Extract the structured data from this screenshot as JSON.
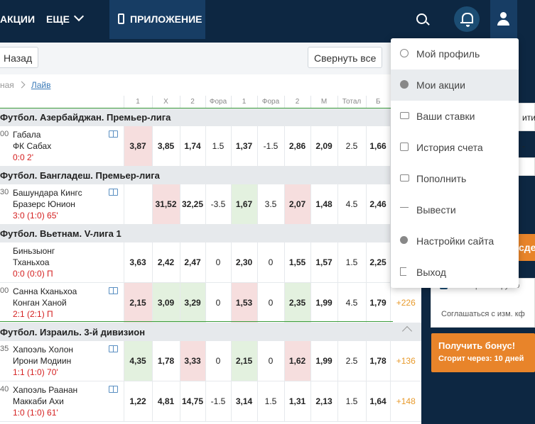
{
  "header": {
    "nav_promo": "АКЦИИ",
    "nav_more": "ЕЩЕ",
    "nav_app": "ПРИЛОЖЕНИЕ"
  },
  "toolbar": {
    "back_label": "Назад",
    "collapse_label": "Свернуть все"
  },
  "breadcrumbs": {
    "home": "ная",
    "current": "Лайв"
  },
  "columns": [
    "1",
    "X",
    "2",
    "Фора",
    "1",
    "Фора",
    "2",
    "М",
    "Тотал",
    "Б"
  ],
  "leagues": [
    {
      "name": "Футбол. Азербайджан. Премьер-лига"
    },
    {
      "name": "Футбол. Бангладеш. Премьер-лига"
    },
    {
      "name": "Футбол. Вьетнам. V-лига 1"
    },
    {
      "name": "Футбол. Израиль. 3-й дивизион"
    }
  ],
  "matches": [
    {
      "time": "00",
      "team1": "Габала",
      "team2": "ФК Сабах",
      "score": "0:0 2'",
      "odds": [
        "3,87",
        "3,85",
        "1,74",
        "1.5",
        "1,37",
        "-1.5",
        "2,86",
        "2,09",
        "2.5",
        "1,66"
      ],
      "more": ""
    },
    {
      "time": "30",
      "team1": "Башундара Кингс",
      "team2": "Бразерс Юнион",
      "score": "3:0 (1:0) 65'",
      "odds": [
        "",
        "31,52",
        "32,25",
        "-3.5",
        "1,67",
        "3.5",
        "2,07",
        "1,48",
        "4.5",
        "2,46"
      ],
      "more": ""
    },
    {
      "time": "",
      "team1": "Биньзыонг",
      "team2": "Тханьхоа",
      "score": "0:0 (0:0) П",
      "odds": [
        "3,63",
        "2,42",
        "2,47",
        "0",
        "2,30",
        "0",
        "1,55",
        "1,57",
        "1.5",
        "2,25"
      ],
      "more": ""
    },
    {
      "time": "00",
      "team1": "Санна Кханьхоа",
      "team2": "Конган Ханой",
      "score": "2:1 (2:1) П",
      "odds": [
        "2,15",
        "3,09",
        "3,29",
        "0",
        "1,53",
        "0",
        "2,35",
        "1,99",
        "4.5",
        "1,79"
      ],
      "more": "+226"
    },
    {
      "time": "35",
      "team1": "Хапоэль Холон",
      "team2": "Ирони Модиин",
      "score": "1:1 (1:0) 70'",
      "odds": [
        "4,35",
        "1,78",
        "3,33",
        "0",
        "2,15",
        "0",
        "1,62",
        "1,99",
        "2.5",
        "1,78"
      ],
      "more": "+136"
    },
    {
      "time": "40",
      "team1": "Хапоэль Раанан",
      "team2": "Маккаби Ахи",
      "score": "1:0 (1:0) 61'",
      "odds": [
        "1,22",
        "4,81",
        "14,75",
        "-1.5",
        "3,14",
        "1.5",
        "1,31",
        "2,13",
        "1.5",
        "1,64"
      ],
      "more": "+148"
    }
  ],
  "dropdown": {
    "items": [
      {
        "label": "Мой профиль",
        "icon": "profile-icon"
      },
      {
        "label": "Мои акции",
        "icon": "promo-check-icon"
      },
      {
        "label": "Ваши ставки",
        "icon": "bets-icon"
      },
      {
        "label": "История счета",
        "icon": "calendar-icon"
      },
      {
        "label": "Пополнить",
        "icon": "card-icon"
      },
      {
        "label": "Вывести",
        "icon": "withdraw-arrows-icon"
      },
      {
        "label": "Настройки сайта",
        "icon": "gear-icon"
      },
      {
        "label": "Выход",
        "icon": "exit-icon"
      }
    ],
    "active_index": 1
  },
  "right": {
    "partial1": "ити -",
    "partial2": "сде",
    "partial3": "о мощте коэфу по",
    "agree_text": "Соглашаться с изм. кф",
    "bonus_title": "Получить бонус!",
    "bonus_sub": "Сгорит через: 10 дней"
  },
  "colors": {
    "header": "#0d2742",
    "accent": "#e8842a",
    "score": "#d41f1f"
  }
}
